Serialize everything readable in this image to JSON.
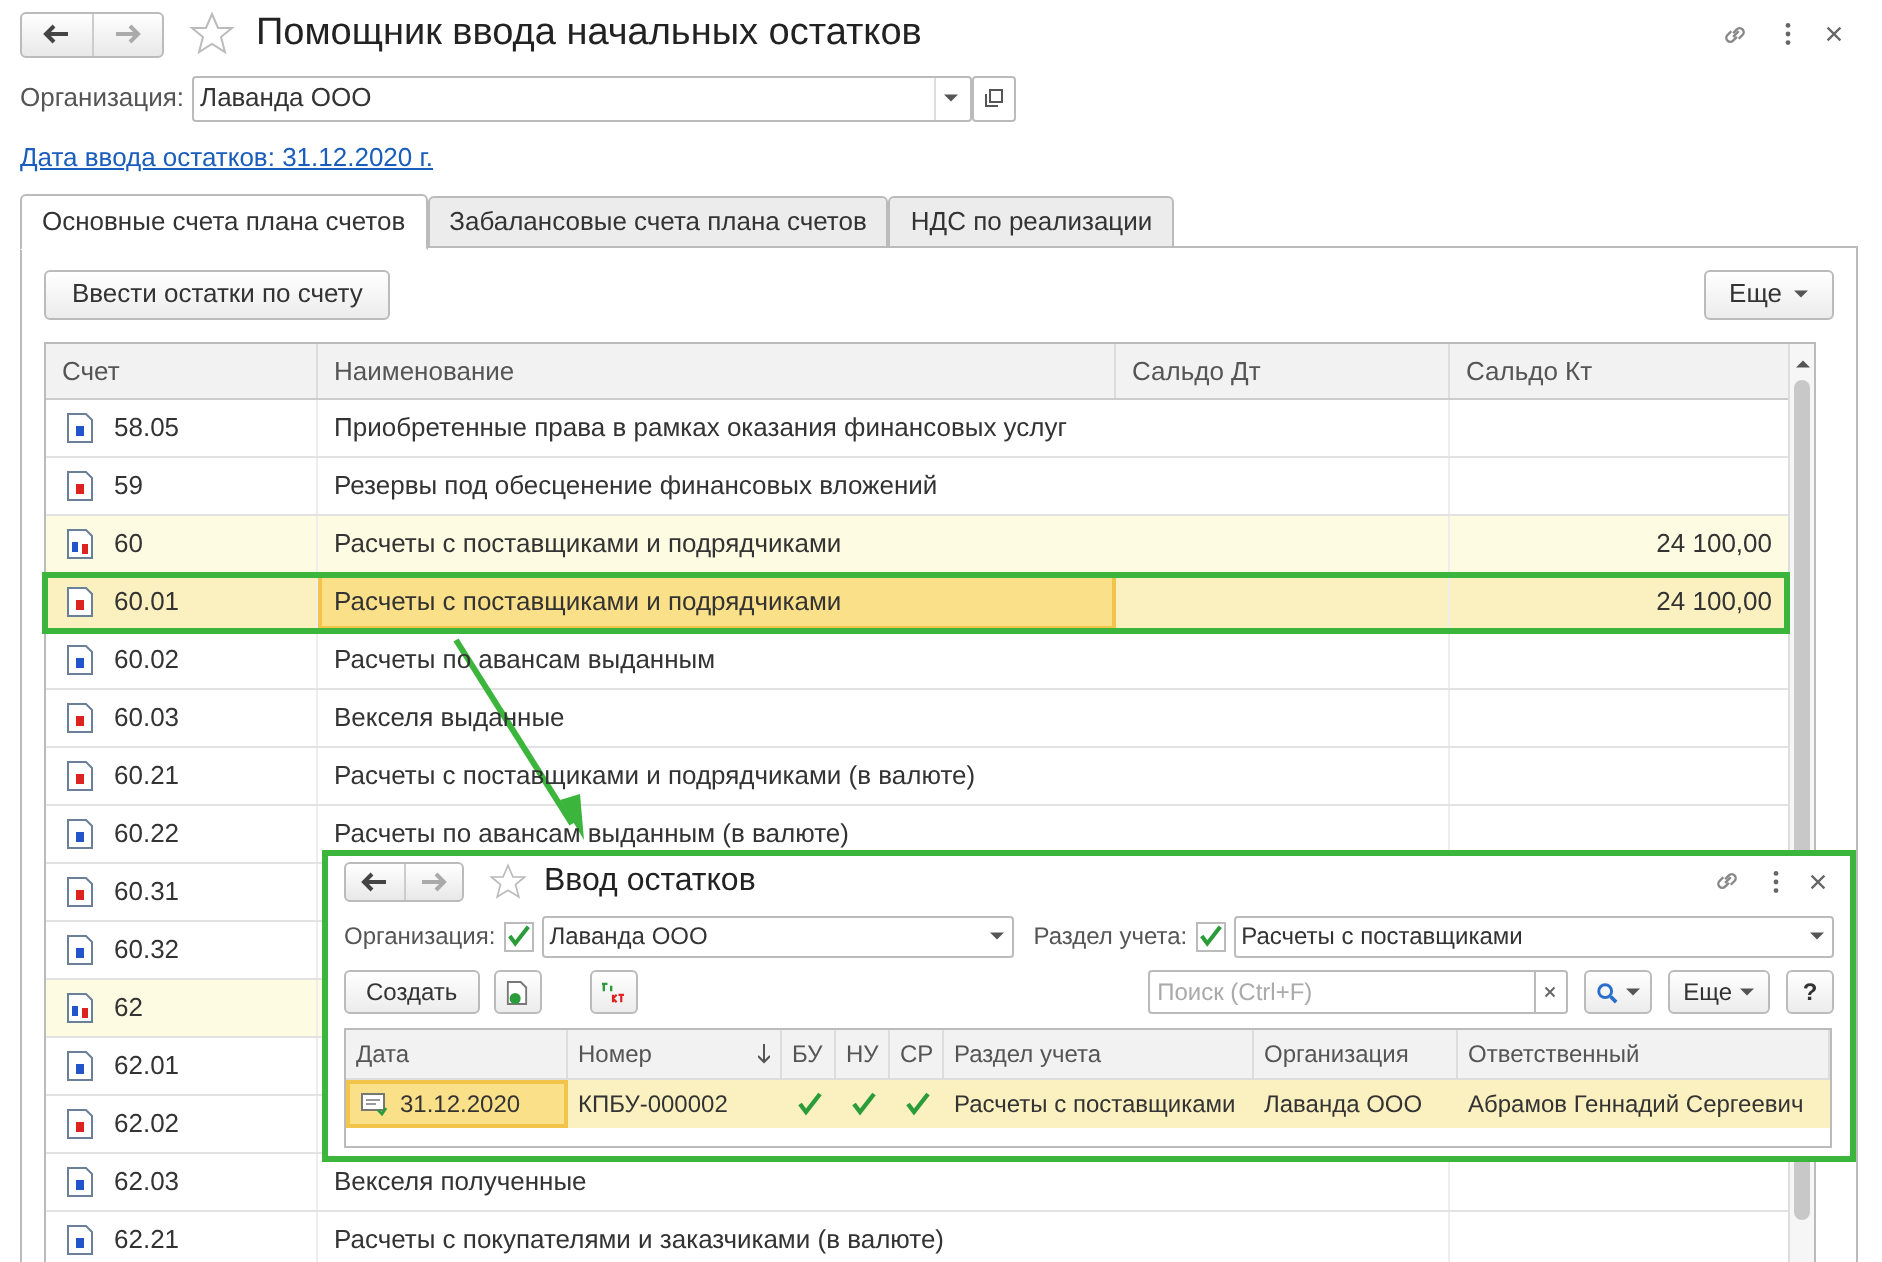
{
  "window": {
    "title": "Помощник ввода начальных остатков"
  },
  "organization": {
    "label": "Организация:",
    "value": "Лаванда ООО"
  },
  "date_link": "Дата ввода остатков: 31.12.2020 г.",
  "tabs": [
    {
      "label": "Основные счета плана счетов",
      "selected": true
    },
    {
      "label": "Забалансовые счета плана счетов",
      "selected": false
    },
    {
      "label": "НДС по реализации",
      "selected": false
    }
  ],
  "toolbar": {
    "enter_button": "Ввести остатки по счету",
    "more_button": "Еще"
  },
  "table": {
    "columns": [
      "Счет",
      "Наименование",
      "Сальдо Дт",
      "Сальдо Кт"
    ],
    "rows": [
      {
        "account": "58.05",
        "kind": "active",
        "group": false,
        "selected": false,
        "name": "Приобретенные права в рамках оказания финансовых услуг"
      },
      {
        "account": "59",
        "kind": "passive",
        "group": false,
        "selected": false,
        "name": "Резервы под обесценение финансовых вложений"
      },
      {
        "account": "60",
        "kind": "active-passive",
        "group": true,
        "selected": false,
        "name": "Расчеты с поставщиками и подрядчиками",
        "credit": "24 100,00"
      },
      {
        "account": "60.01",
        "kind": "passive",
        "group": false,
        "selected": true,
        "name": "Расчеты с поставщиками и подрядчиками",
        "credit": "24 100,00"
      },
      {
        "account": "60.02",
        "kind": "active",
        "group": false,
        "selected": false,
        "name": "Расчеты по авансам выданным"
      },
      {
        "account": "60.03",
        "kind": "passive",
        "group": false,
        "selected": false,
        "name": "Векселя выданные"
      },
      {
        "account": "60.21",
        "kind": "passive",
        "group": false,
        "selected": false,
        "name": "Расчеты с поставщиками и подрядчиками (в валюте)"
      },
      {
        "account": "60.22",
        "kind": "active",
        "group": false,
        "selected": false,
        "name": "Расчеты по авансам выданным (в валюте)"
      },
      {
        "account": "60.31",
        "kind": "passive",
        "group": false,
        "selected": false
      },
      {
        "account": "60.32",
        "kind": "active",
        "group": false,
        "selected": false
      },
      {
        "account": "62",
        "kind": "active-passive",
        "group": true,
        "selected": false
      },
      {
        "account": "62.01",
        "kind": "active",
        "group": false,
        "selected": false
      },
      {
        "account": "62.02",
        "kind": "passive",
        "group": false,
        "selected": false
      },
      {
        "account": "62.03",
        "kind": "active",
        "group": false,
        "selected": false,
        "name": "Векселя полученные"
      },
      {
        "account": "62.21",
        "kind": "active",
        "group": false,
        "selected": false,
        "name": "Расчеты с покупателями и заказчиками (в валюте)"
      }
    ]
  },
  "dialog": {
    "title": "Ввод остатков",
    "org_filter": {
      "label": "Организация:",
      "checked": true,
      "value": "Лаванда ООО"
    },
    "section_filter": {
      "label": "Раздел учета:",
      "checked": true,
      "value": "Расчеты с поставщиками"
    },
    "create_button": "Создать",
    "search_placeholder": "Поиск (Ctrl+F)",
    "more_button": "Еще",
    "help_button": "?",
    "columns": [
      "Дата",
      "Номер",
      "БУ",
      "НУ",
      "СР",
      "Раздел учета",
      "Организация",
      "Ответственный"
    ],
    "rows": [
      {
        "date": "31.12.2020",
        "number": "КПБУ-000002",
        "bu": true,
        "nu": true,
        "sr": true,
        "section": "Расчеты с поставщиками",
        "organization": "Лаванда ООО",
        "responsible": "Абрамов Геннадий Сергеевич",
        "selected": true
      }
    ]
  }
}
